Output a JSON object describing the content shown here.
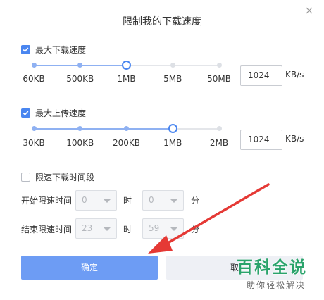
{
  "dialog": {
    "title": "限制我的下载速度",
    "download": {
      "label": "最大下载速度",
      "checked": true,
      "ticks": [
        "60KB",
        "500KB",
        "1MB",
        "5MB",
        "50MB"
      ],
      "selected_index": 2,
      "value": "1024",
      "unit": "KB/s"
    },
    "upload": {
      "label": "最大上传速度",
      "checked": true,
      "ticks": [
        "30KB",
        "100KB",
        "200KB",
        "1MB",
        "2MB"
      ],
      "selected_index": 3,
      "value": "1024",
      "unit": "KB/s"
    },
    "schedule": {
      "label": "限速下载时间段",
      "checked": false,
      "start_label": "开始限速时间",
      "start_hour": "0",
      "start_minute": "0",
      "end_label": "结束限速时间",
      "end_hour": "23",
      "end_minute": "59",
      "hour_suffix": "时",
      "minute_suffix": "分"
    },
    "buttons": {
      "ok": "确定",
      "cancel": "取"
    }
  },
  "watermark": {
    "title": "百科全说",
    "subtitle": "助你轻松解决"
  },
  "colors": {
    "accent": "#4a86f0",
    "button": "#6d9cf4",
    "arrow": "#e53935",
    "watermark": "#2aa36b"
  }
}
